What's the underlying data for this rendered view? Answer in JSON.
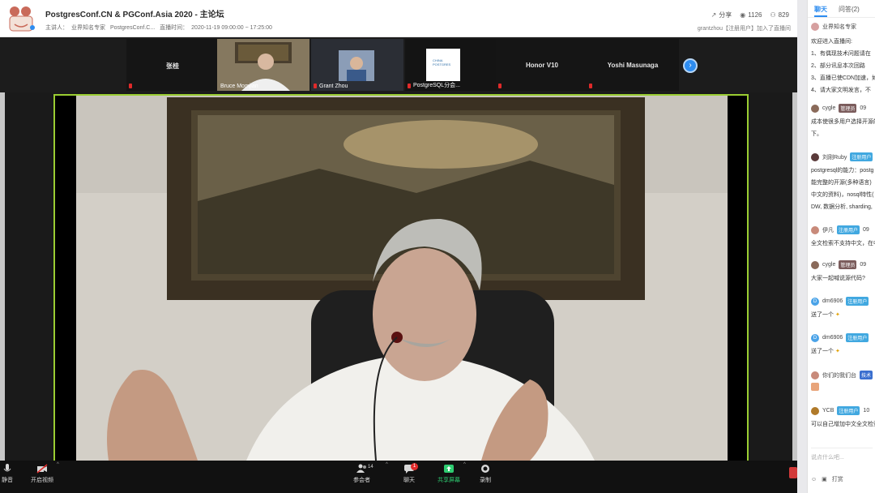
{
  "header": {
    "title": "PostgresConf.CN & PGConf.Asia 2020 - 主论坛",
    "host_label": "主讲人：",
    "host_value": "业界知名专家",
    "host_value2": "PostgresConf.C...",
    "time_label": "直播时间：",
    "time_value": "2020-11-19 09:00:00 ~ 17:25:00",
    "share_label": "分享",
    "views": "1126",
    "participants": "829",
    "join_notice": "grantzhou【注册用户】加入了直播间"
  },
  "participants": [
    {
      "name": "张桂",
      "caption": ""
    },
    {
      "name": "",
      "caption": "Bruce Momjian"
    },
    {
      "name": "",
      "caption": "Grant Zhou"
    },
    {
      "name": "",
      "caption": "PostgreSQL分会..."
    },
    {
      "name": "Honor V10",
      "caption": ""
    },
    {
      "name": "Yoshi Masunaga",
      "caption": ""
    }
  ],
  "controls": {
    "unmute": "静音",
    "video": "开启视频",
    "participants": "参会者",
    "participants_count": "14",
    "chat": "聊天",
    "chat_badge": "1",
    "share": "共享屏幕",
    "record": "录制"
  },
  "sidebar": {
    "tab_chat": "聊天",
    "tab_qa": "问答(2)",
    "host_name": "业界知名专家",
    "welcome": "欢迎进入直播间:",
    "rules": [
      "1、有偶现技术问题请在",
      "2、部分讯息本次回路",
      "3、直播已使CDN加速，如",
      "4、请大家文明发言，不"
    ],
    "messages": [
      {
        "user": "cygle",
        "tag": "管理员",
        "time": "09",
        "lines": [
          "成本使很多用户选择开源的",
          "下。"
        ]
      },
      {
        "user": "刘刚Ruby",
        "tag": "注册用户",
        "time": "",
        "lines": [
          "postgresql的能力：postg",
          "能完整的开源(多种语言)",
          "中文的资料)，nosql特性(",
          "DW, 数据分析, sharding,"
        ]
      },
      {
        "user": "伊凡",
        "tag": "注册用户",
        "time": "09",
        "lines": [
          "全文检索不支持中文，在中"
        ]
      },
      {
        "user": "cygle",
        "tag": "管理员",
        "time": "09",
        "lines": [
          "大家一起喊说源代码?"
        ]
      },
      {
        "user": "dm6906",
        "tag": "注册用户",
        "time": "",
        "lines": [
          "送了一个"
        ]
      },
      {
        "user": "dm6906",
        "tag": "注册用户",
        "time": "",
        "lines": [
          "送了一个"
        ]
      },
      {
        "user": "你们的我们台",
        "tag": "技术",
        "time": "",
        "lines": [
          ""
        ]
      },
      {
        "user": "YCB",
        "tag": "注册用户",
        "time": "10",
        "lines": [
          "可以自己增加中文全文检索"
        ]
      }
    ],
    "input_placeholder": "说点什么吧...",
    "footer_label": "打赏"
  }
}
